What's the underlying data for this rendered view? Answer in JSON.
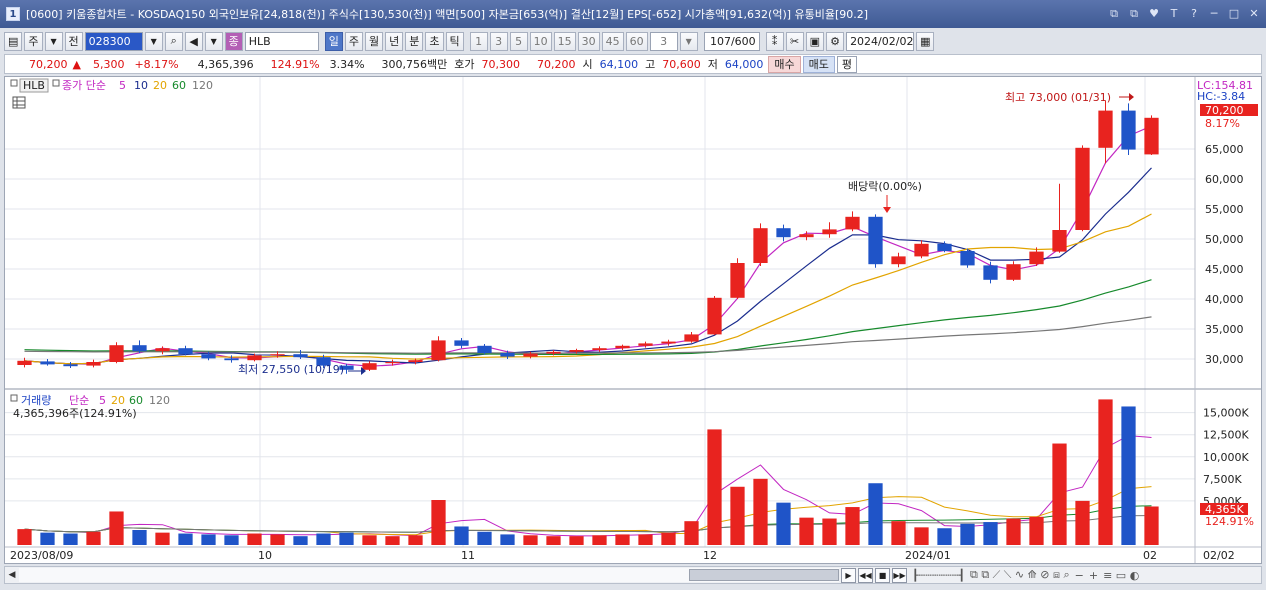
{
  "window": {
    "title": "[0600] 키움종합차트 - KOSDAQ150 외국인보유[24,818(천)] 주식수[130,530(천)] 액면[500] 자본금[653(억)] 결산[12월] EPS[-652] 시가총액[91,632(억)] 유통비율[90.2]",
    "icon_label": "1",
    "buttons": [
      "⧉",
      "⧉",
      "♥",
      "T",
      "?",
      "─",
      "□",
      "✕"
    ]
  },
  "toolbar": {
    "period_unit": "주",
    "prev_label": "전",
    "code": "028300",
    "stock_name": "HLB",
    "period_buttons": [
      "일",
      "주",
      "월",
      "년",
      "분",
      "초",
      "틱"
    ],
    "selected_period": "일",
    "interval_buttons": [
      "1",
      "3",
      "5",
      "10",
      "15",
      "30",
      "45",
      "60"
    ],
    "interval_value": "3",
    "count_display": "107/600",
    "date": "2024/02/02"
  },
  "quote": {
    "price": "70,200",
    "change": "5,300",
    "change_pct": "+8.17%",
    "volume": "4,365,396",
    "volume_ratio": "124.91%",
    "turnover": "3.34%",
    "trade_value": "300,756백만",
    "hoga_label": "호가",
    "ask": "70,300",
    "bid": "70,200",
    "open_label": "시",
    "open": "64,100",
    "high_label": "고",
    "high": "70,600",
    "low_label": "저",
    "low": "64,000",
    "buy_label": "매수",
    "sell_label": "매도",
    "pyeong_label": "평"
  },
  "price_panel": {
    "legend_stock": "HLB",
    "legend_title": "종가 단순",
    "ma_labels": [
      "5",
      "10",
      "20",
      "60",
      "120"
    ],
    "ma_colors": [
      "#c227c2",
      "#1b2d8e",
      "#e2a400",
      "#178a2c",
      "#777777"
    ],
    "right_labels": [
      "LC:154.81",
      "HC:-3.84"
    ],
    "current_price_label": "70,200",
    "current_pct_label": "8.17%",
    "y_ticks": [
      "65,000",
      "60,000",
      "55,000",
      "50,000",
      "45,000",
      "40,000",
      "35,000",
      "30,000"
    ],
    "annotations": {
      "high": "최고 73,000 (01/31)",
      "low": "최저 27,550 (10/19)",
      "dividend": "배당락(0.00%)"
    }
  },
  "volume_panel": {
    "legend_title": "거래량",
    "legend_ma": "단순",
    "ma_labels": [
      "5",
      "20",
      "60",
      "120"
    ],
    "summary": "4,365,396주(124.91%)",
    "y_ticks": [
      "15,000K",
      "12,500K",
      "10,000K",
      "7,500K",
      "5,000K"
    ],
    "current_label": "4,365K",
    "current_pct_label": "124.91%"
  },
  "x_axis": {
    "labels": [
      "2023/08/09",
      "10",
      "11",
      "12",
      "2024/01",
      "02"
    ],
    "last_date": "02/02"
  },
  "colors": {
    "up": "#e8231f",
    "down": "#1f54c8",
    "accent": "#4e77c8",
    "grid": "#e3e6ec"
  },
  "chart_data": {
    "type": "candlestick",
    "title": "HLB",
    "unit": "KRW",
    "candles_sampled": [
      {
        "o": 29000,
        "h": 30200,
        "l": 28600,
        "c": 29700
      },
      {
        "o": 29600,
        "h": 30000,
        "l": 28900,
        "c": 29100
      },
      {
        "o": 29100,
        "h": 29500,
        "l": 28500,
        "c": 28800
      },
      {
        "o": 28900,
        "h": 29900,
        "l": 28600,
        "c": 29500
      },
      {
        "o": 29500,
        "h": 32800,
        "l": 29300,
        "c": 32300
      },
      {
        "o": 32300,
        "h": 33100,
        "l": 31000,
        "c": 31300
      },
      {
        "o": 31300,
        "h": 32100,
        "l": 30800,
        "c": 31800
      },
      {
        "o": 31800,
        "h": 32200,
        "l": 30600,
        "c": 30800
      },
      {
        "o": 30800,
        "h": 31200,
        "l": 29800,
        "c": 30100
      },
      {
        "o": 30100,
        "h": 30600,
        "l": 29400,
        "c": 29800
      },
      {
        "o": 29800,
        "h": 30900,
        "l": 29600,
        "c": 30600
      },
      {
        "o": 30600,
        "h": 31300,
        "l": 30200,
        "c": 30800
      },
      {
        "o": 30800,
        "h": 31500,
        "l": 30000,
        "c": 30300
      },
      {
        "o": 30300,
        "h": 30700,
        "l": 28500,
        "c": 28900
      },
      {
        "o": 28900,
        "h": 29200,
        "l": 27550,
        "c": 28200
      },
      {
        "o": 28200,
        "h": 29600,
        "l": 28000,
        "c": 29300
      },
      {
        "o": 29300,
        "h": 29900,
        "l": 28900,
        "c": 29500
      },
      {
        "o": 29500,
        "h": 30100,
        "l": 29100,
        "c": 29800
      },
      {
        "o": 29800,
        "h": 33800,
        "l": 29600,
        "c": 33100
      },
      {
        "o": 33100,
        "h": 33500,
        "l": 31800,
        "c": 32200
      },
      {
        "o": 32200,
        "h": 32500,
        "l": 30800,
        "c": 31000
      },
      {
        "o": 31000,
        "h": 31400,
        "l": 30000,
        "c": 30400
      },
      {
        "o": 30400,
        "h": 31200,
        "l": 30100,
        "c": 30900
      },
      {
        "o": 30900,
        "h": 31500,
        "l": 30600,
        "c": 31200
      },
      {
        "o": 31200,
        "h": 31700,
        "l": 30900,
        "c": 31500
      },
      {
        "o": 31500,
        "h": 32100,
        "l": 31200,
        "c": 31800
      },
      {
        "o": 31800,
        "h": 32400,
        "l": 31500,
        "c": 32200
      },
      {
        "o": 32200,
        "h": 32900,
        "l": 31900,
        "c": 32600
      },
      {
        "o": 32600,
        "h": 33200,
        "l": 32200,
        "c": 32900
      },
      {
        "o": 32900,
        "h": 34500,
        "l": 32700,
        "c": 34100
      },
      {
        "o": 34100,
        "h": 40500,
        "l": 34000,
        "c": 40200
      },
      {
        "o": 40200,
        "h": 46800,
        "l": 40000,
        "c": 46000
      },
      {
        "o": 46000,
        "h": 52600,
        "l": 45500,
        "c": 51800
      },
      {
        "o": 51800,
        "h": 52400,
        "l": 49600,
        "c": 50300
      },
      {
        "o": 50300,
        "h": 51300,
        "l": 49800,
        "c": 50800
      },
      {
        "o": 50800,
        "h": 52800,
        "l": 50200,
        "c": 51600
      },
      {
        "o": 51600,
        "h": 54600,
        "l": 51300,
        "c": 53700
      },
      {
        "o": 53700,
        "h": 54100,
        "l": 45200,
        "c": 45800
      },
      {
        "o": 45800,
        "h": 47700,
        "l": 45300,
        "c": 47100
      },
      {
        "o": 47100,
        "h": 49800,
        "l": 46800,
        "c": 49200
      },
      {
        "o": 49200,
        "h": 49600,
        "l": 47800,
        "c": 48000
      },
      {
        "o": 48000,
        "h": 48400,
        "l": 45200,
        "c": 45600
      },
      {
        "o": 45600,
        "h": 46200,
        "l": 42600,
        "c": 43200
      },
      {
        "o": 43200,
        "h": 46300,
        "l": 43000,
        "c": 45800
      },
      {
        "o": 45800,
        "h": 48600,
        "l": 45500,
        "c": 47900
      },
      {
        "o": 47900,
        "h": 59200,
        "l": 47700,
        "c": 51500
      },
      {
        "o": 51500,
        "h": 65600,
        "l": 51300,
        "c": 65200
      },
      {
        "o": 65200,
        "h": 73000,
        "l": 62600,
        "c": 71400
      },
      {
        "o": 71400,
        "h": 72600,
        "l": 64000,
        "c": 64900
      },
      {
        "o": 64100,
        "h": 70600,
        "l": 64000,
        "c": 70200
      }
    ],
    "volume_sampled_k": [
      1800,
      1400,
      1300,
      1500,
      3800,
      1700,
      1400,
      1300,
      1200,
      1100,
      1300,
      1200,
      1000,
      1300,
      1400,
      1100,
      1000,
      1100,
      5100,
      2100,
      1500,
      1200,
      1100,
      1000,
      1000,
      1100,
      1200,
      1200,
      1400,
      2700,
      13100,
      6600,
      7500,
      4800,
      3100,
      3000,
      4300,
      7000,
      2700,
      2000,
      1900,
      2400,
      2600,
      3000,
      3200,
      11500,
      5000,
      16500,
      15700,
      4365
    ],
    "ylim": [
      26000,
      76000
    ],
    "volume_ylim_k": [
      0,
      17000
    ]
  }
}
